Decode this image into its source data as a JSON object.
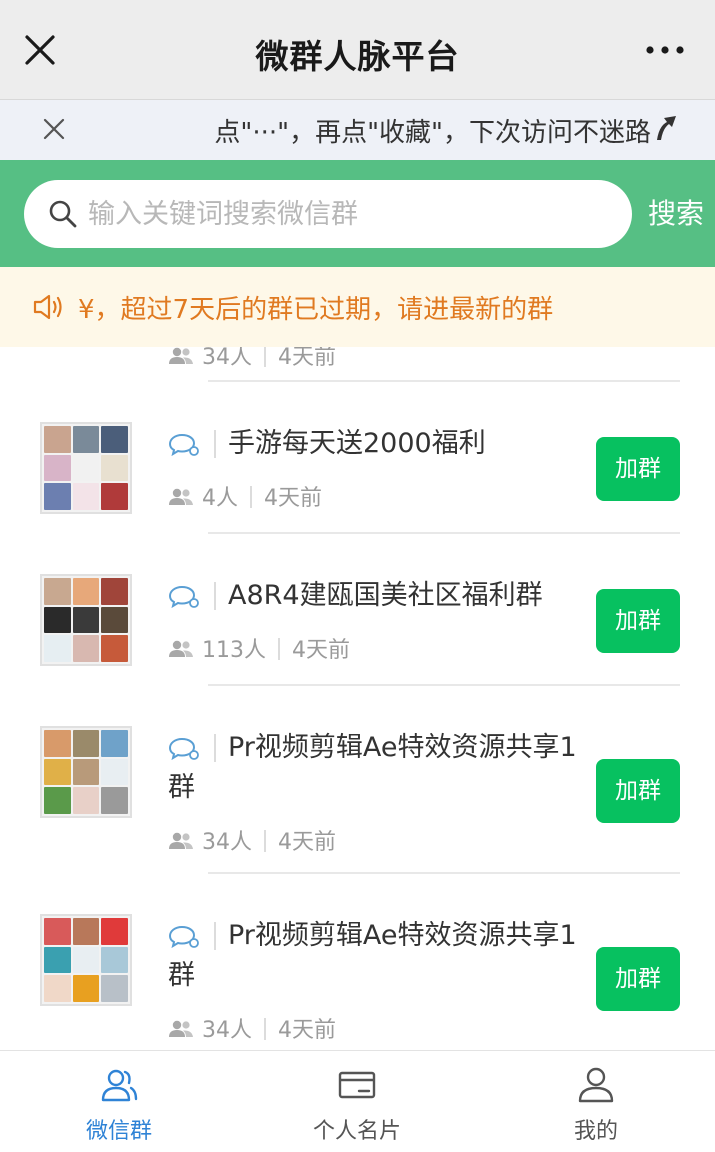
{
  "header": {
    "title": "微群人脉平台"
  },
  "tip": {
    "text": "点\"···\"，再点\"收藏\"，下次访问不迷路"
  },
  "search": {
    "placeholder": "输入关键词搜索微信群",
    "button_label": "搜索"
  },
  "notice": {
    "text": "¥，超过7天后的群已过期，请进最新的群"
  },
  "partial_item": {
    "members": "34人",
    "time": "4天前"
  },
  "groups": [
    {
      "name": "手游每天送2000福利",
      "members": "4人",
      "time": "4天前",
      "join_label": "加群",
      "avatar_colors": [
        "#c9a48f",
        "#7a8a99",
        "#4b5e7a",
        "#d8b4c8",
        "#f1f1f1",
        "#e8e0d0",
        "#6c7fb0",
        "#f3e3e8",
        "#b03a3a"
      ]
    },
    {
      "name": "A8R4建瓯国美社区福利群",
      "members": "113人",
      "time": "4天前",
      "join_label": "加群",
      "avatar_colors": [
        "#c8a890",
        "#e7a87a",
        "#a0453a",
        "#2a2a2a",
        "#3a3a3a",
        "#5a4a3a",
        "#e6eef2",
        "#d8b8b0",
        "#c65a3a"
      ]
    },
    {
      "name": "Pr视频剪辑Ae特效资源共享1群",
      "members": "34人",
      "time": "4天前",
      "join_label": "加群",
      "avatar_colors": [
        "#d89a6a",
        "#9a8a6a",
        "#6fa2c9",
        "#e0b048",
        "#b89a7a",
        "#e8eef2",
        "#5a9a4a",
        "#e8d0c8",
        "#9a9a9a"
      ]
    },
    {
      "name": "Pr视频剪辑Ae特效资源共享1群",
      "members": "34人",
      "time": "4天前",
      "join_label": "加群",
      "avatar_colors": [
        "#d85a5a",
        "#b8785a",
        "#e03a3a",
        "#3aa0b0",
        "#e8eef2",
        "#a8c8d8",
        "#f0d8c8",
        "#e8a020",
        "#b8c0c8"
      ]
    }
  ],
  "tabs": [
    {
      "label": "微信群",
      "icon": "people-icon",
      "active": true
    },
    {
      "label": "个人名片",
      "icon": "card-icon",
      "active": false
    },
    {
      "label": "我的",
      "icon": "user-icon",
      "active": false
    }
  ],
  "colors": {
    "accent_green": "#56bf84",
    "button_green": "#07c160",
    "notice_orange": "#e07a21",
    "tab_active": "#2f83d6"
  }
}
